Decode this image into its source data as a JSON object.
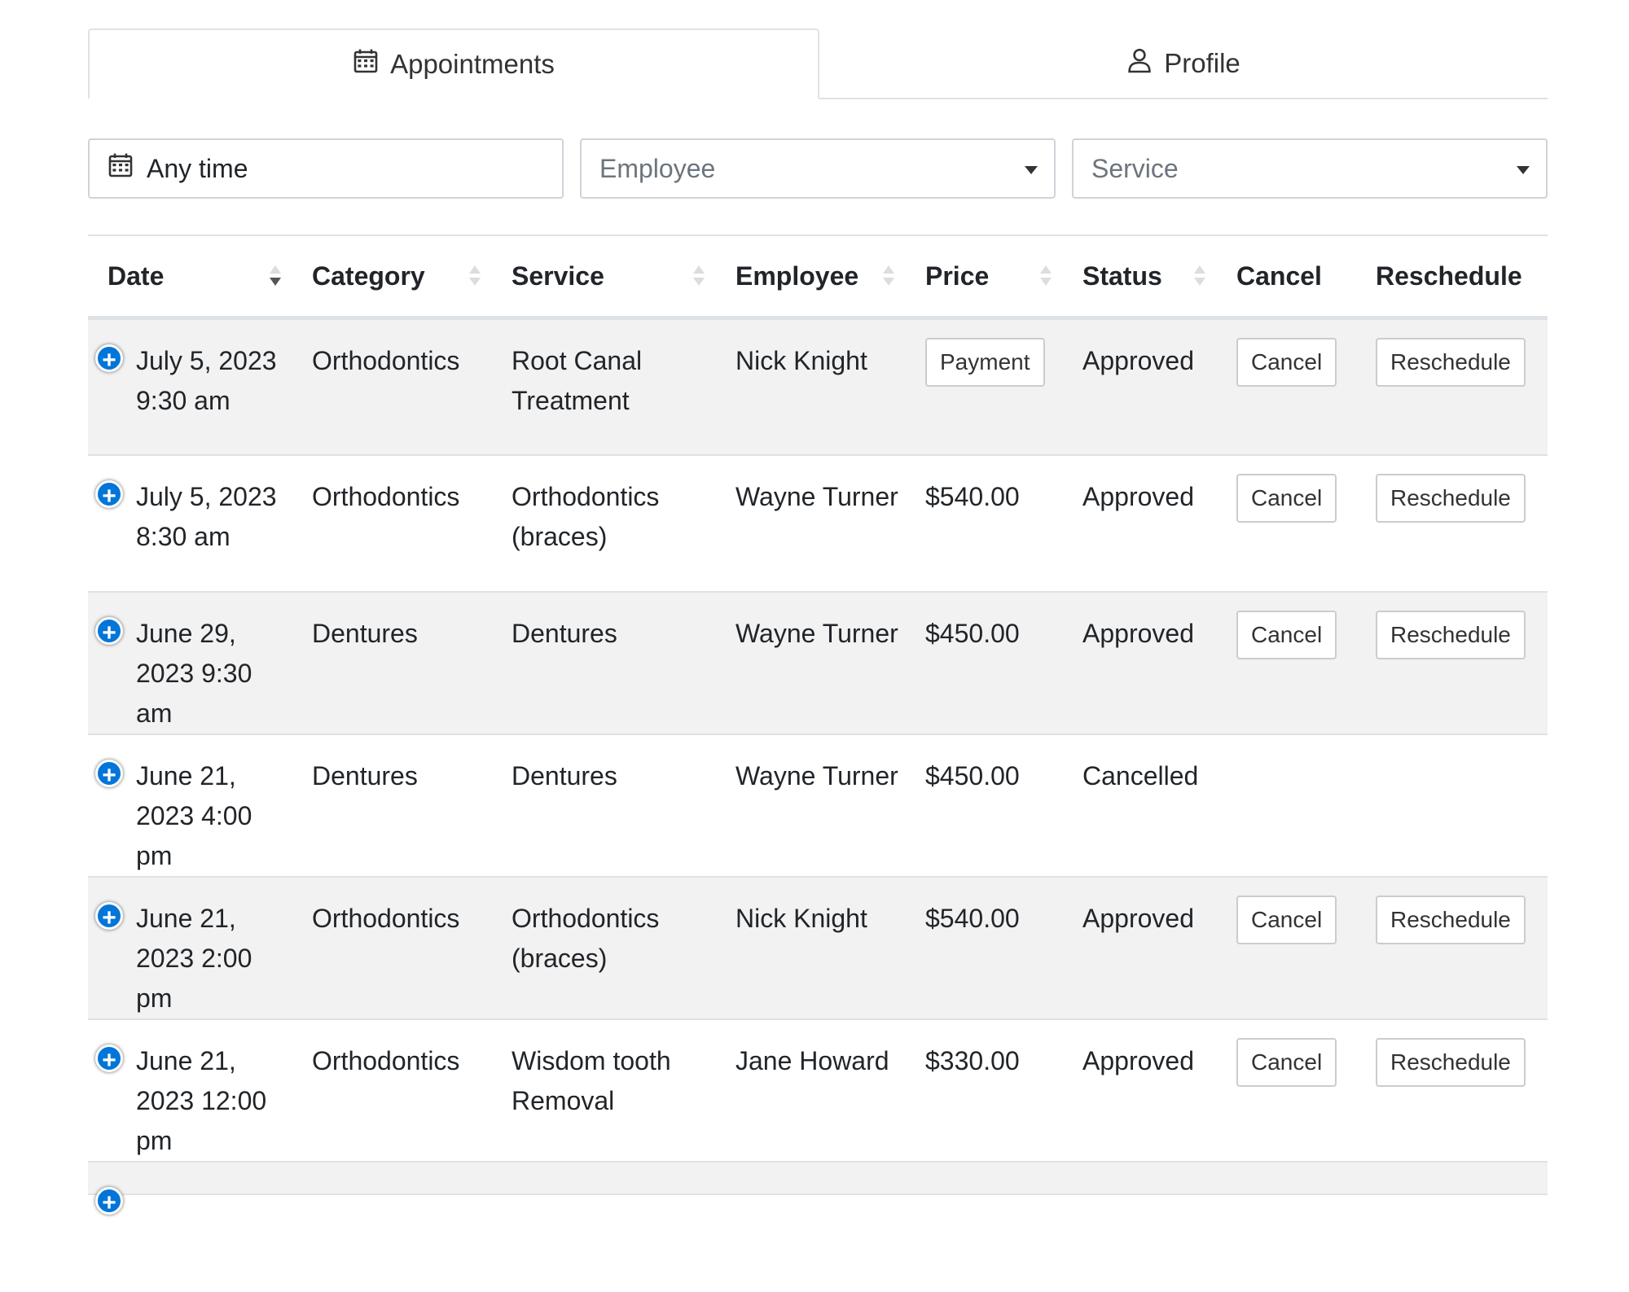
{
  "tabs": [
    {
      "label": "Appointments",
      "icon": "calendar-icon",
      "active": true
    },
    {
      "label": "Profile",
      "icon": "user-icon",
      "active": false
    }
  ],
  "filters": {
    "date": {
      "value": "Any time",
      "icon": "calendar-icon"
    },
    "employee": {
      "placeholder": "Employee"
    },
    "service": {
      "placeholder": "Service"
    }
  },
  "table": {
    "headers": {
      "date": "Date",
      "category": "Category",
      "service": "Service",
      "employee": "Employee",
      "price": "Price",
      "status": "Status",
      "cancel": "Cancel",
      "reschedule": "Reschedule"
    },
    "rows": [
      {
        "date": "July 5, 2023 9:30 am",
        "category": "Orthodontics",
        "service": "Root Canal Treatment",
        "employee": "Nick Knight",
        "price_button": "Payment",
        "status": "Approved",
        "cancel": "Cancel",
        "reschedule": "Reschedule"
      },
      {
        "date": "July 5, 2023 8:30 am",
        "category": "Orthodontics",
        "service": "Orthodontics (braces)",
        "employee": "Wayne Turner",
        "price": "$540.00",
        "status": "Approved",
        "cancel": "Cancel",
        "reschedule": "Reschedule"
      },
      {
        "date": "June 29, 2023 9:30 am",
        "category": "Dentures",
        "service": "Dentures",
        "employee": "Wayne Turner",
        "price": "$450.00",
        "status": "Approved",
        "cancel": "Cancel",
        "reschedule": "Reschedule"
      },
      {
        "date": "June 21, 2023 4:00 pm",
        "category": "Dentures",
        "service": "Dentures",
        "employee": "Wayne Turner",
        "price": "$450.00",
        "status": "Cancelled"
      },
      {
        "date": "June 21, 2023 2:00 pm",
        "category": "Orthodontics",
        "service": "Orthodontics (braces)",
        "employee": "Nick Knight",
        "price": "$540.00",
        "status": "Approved",
        "cancel": "Cancel",
        "reschedule": "Reschedule"
      },
      {
        "date": "June 21, 2023 12:00 pm",
        "category": "Orthodontics",
        "service": "Wisdom tooth Removal",
        "employee": "Jane Howard",
        "price": "$330.00",
        "status": "Approved",
        "cancel": "Cancel",
        "reschedule": "Reschedule"
      }
    ]
  },
  "colors": {
    "expand_button": "#0275d8",
    "stripe": "#f2f2f2",
    "border": "#dee2e6"
  }
}
